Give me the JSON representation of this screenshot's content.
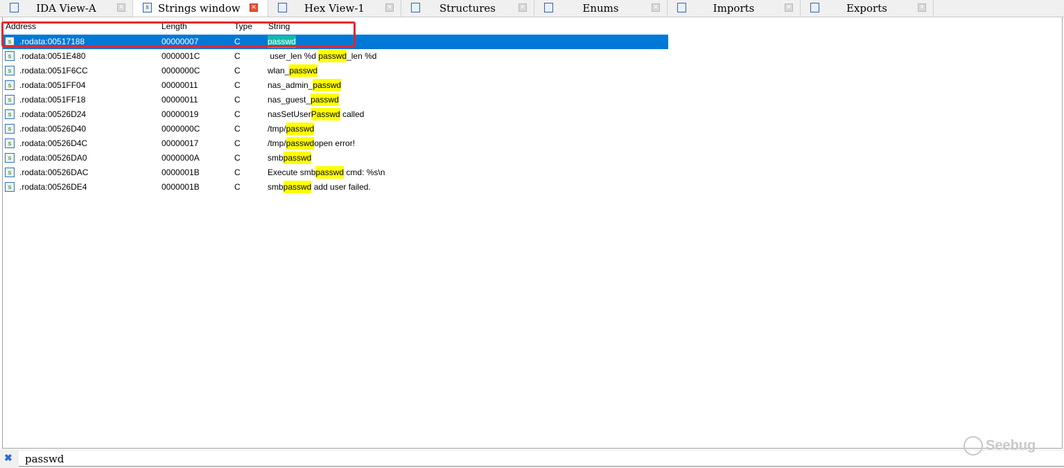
{
  "tabs": [
    {
      "label": "IDA View-A",
      "icon": "disassembly-icon",
      "active": false
    },
    {
      "label": "Strings window",
      "icon": "strings-icon",
      "active": true
    },
    {
      "label": "Hex View-1",
      "icon": "hex-icon",
      "active": false
    },
    {
      "label": "Structures",
      "icon": "structures-icon",
      "active": false
    },
    {
      "label": "Enums",
      "icon": "enums-icon",
      "active": false
    },
    {
      "label": "Imports",
      "icon": "imports-icon",
      "active": false
    },
    {
      "label": "Exports",
      "icon": "exports-icon",
      "active": false
    }
  ],
  "columns": {
    "address": "Address",
    "length": "Length",
    "type": "Type",
    "string": "String"
  },
  "rows": [
    {
      "address": ".rodata:00517188",
      "length": "00000007",
      "type": "C",
      "pre": "",
      "hl": "passwd",
      "post": "",
      "selected": true
    },
    {
      "address": ".rodata:0051E480",
      "length": "0000001C",
      "type": "C",
      "pre": " user_len %d ",
      "hl": "passwd",
      "post": "_len %d"
    },
    {
      "address": ".rodata:0051F6CC",
      "length": "0000000C",
      "type": "C",
      "pre": "wlan_",
      "hl": "passwd",
      "post": ""
    },
    {
      "address": ".rodata:0051FF04",
      "length": "00000011",
      "type": "C",
      "pre": "nas_admin_",
      "hl": "passwd",
      "post": ""
    },
    {
      "address": ".rodata:0051FF18",
      "length": "00000011",
      "type": "C",
      "pre": "nas_guest_",
      "hl": "passwd",
      "post": ""
    },
    {
      "address": ".rodata:00526D24",
      "length": "00000019",
      "type": "C",
      "pre": "nasSetUser",
      "hl": "Passwd",
      "post": " called"
    },
    {
      "address": ".rodata:00526D40",
      "length": "0000000C",
      "type": "C",
      "pre": "/tmp/",
      "hl": "passwd",
      "post": ""
    },
    {
      "address": ".rodata:00526D4C",
      "length": "00000017",
      "type": "C",
      "pre": "/tmp/",
      "hl": "passwd",
      "post": "open error!"
    },
    {
      "address": ".rodata:00526DA0",
      "length": "0000000A",
      "type": "C",
      "pre": "smb",
      "hl": "passwd",
      "post": ""
    },
    {
      "address": ".rodata:00526DAC",
      "length": "0000001B",
      "type": "C",
      "pre": "Execute smb",
      "hl": "passwd",
      "post": " cmd: %s\\n"
    },
    {
      "address": ".rodata:00526DE4",
      "length": "0000001B",
      "type": "C",
      "pre": "smb",
      "hl": "passwd",
      "post": " add user failed."
    }
  ],
  "filter": {
    "value": "passwd"
  },
  "watermark": "Seebug"
}
